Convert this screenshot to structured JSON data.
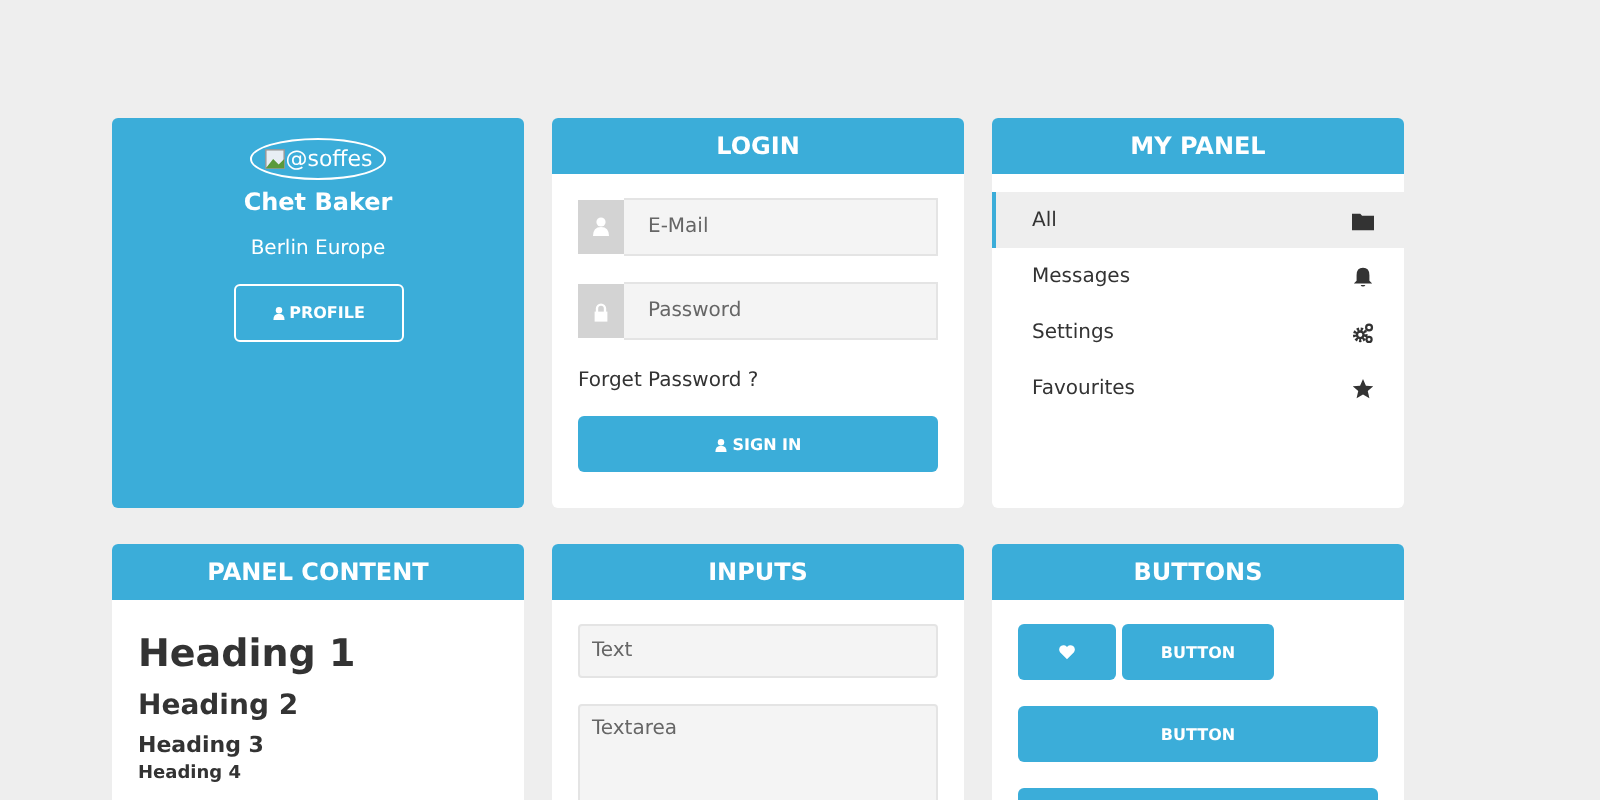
{
  "profile": {
    "avatar_alt": "@soffes",
    "name": "Chet Baker",
    "location": "Berlin Europe",
    "button": "PROFILE"
  },
  "login": {
    "title": "LOGIN",
    "fields": [
      {
        "kind": "user",
        "placeholder": "E-Mail"
      },
      {
        "kind": "lock",
        "placeholder": "Password"
      }
    ],
    "forgot": "Forget Password ?",
    "button": "SIGN IN"
  },
  "my_panel": {
    "title": "MY PANEL",
    "items": [
      {
        "label": "All",
        "kind": "folder",
        "selected": true
      },
      {
        "label": "Messages",
        "kind": "bell",
        "selected": false
      },
      {
        "label": "Settings",
        "kind": "gears",
        "selected": false
      },
      {
        "label": "Favourites",
        "kind": "star",
        "selected": false
      }
    ]
  },
  "panel_content": {
    "title": "PANEL CONTENT",
    "headings": [
      "Heading 1",
      "Heading 2",
      "Heading 3",
      "Heading 4"
    ]
  },
  "inputs": {
    "title": "INPUTS",
    "text_placeholder": "Text",
    "textarea_placeholder": "Textarea"
  },
  "buttons": {
    "title": "BUTTONS",
    "row": [
      {
        "kind": "heart"
      },
      {
        "kind": "text",
        "label": "BUTTON"
      }
    ],
    "full": [
      {
        "kind": "text",
        "label": "BUTTON"
      },
      {
        "kind": "blank"
      }
    ]
  }
}
